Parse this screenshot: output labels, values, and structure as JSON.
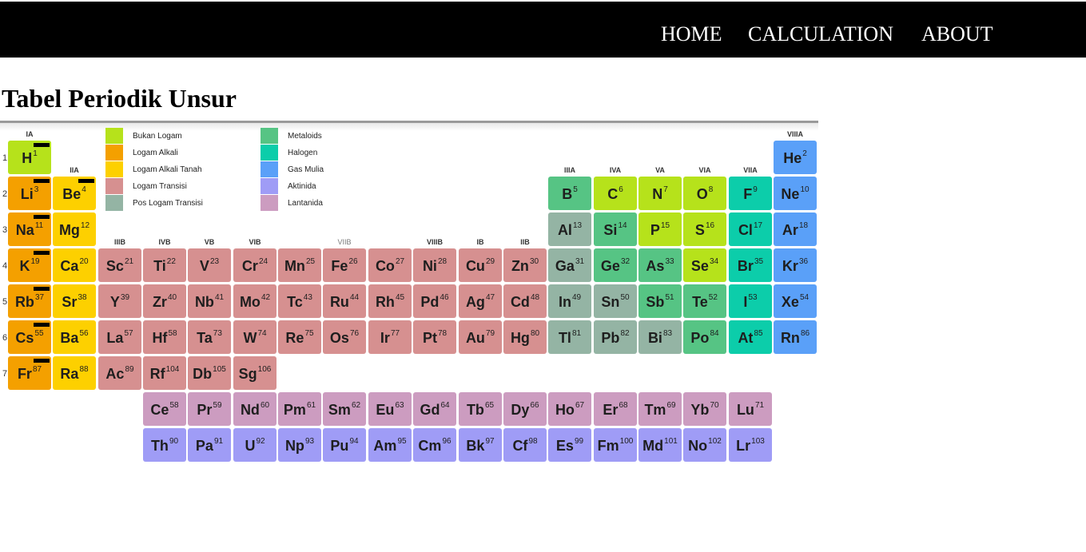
{
  "nav": {
    "items": [
      "HOME",
      "CALCULATION",
      "ABOUT"
    ]
  },
  "page": {
    "title": "Tabel Periodik Unsur"
  },
  "colors": {
    "nonmetal": "#b6e21b",
    "alkali": "#f4a000",
    "alkaline": "#fdd000",
    "transition": "#d69090",
    "post": "#94b4a4",
    "metalloid": "#56c484",
    "halogen": "#0ccdaa",
    "noble": "#5aa0f8",
    "actinide": "#9f9cf6",
    "lanthanide": "#cc9cc0"
  },
  "legend": [
    {
      "label": "Bukan Logam",
      "cat": "nonmetal"
    },
    {
      "label": "Logam Alkali",
      "cat": "alkali"
    },
    {
      "label": "Logam Alkali Tanah",
      "cat": "alkaline"
    },
    {
      "label": "Logam Transisi",
      "cat": "transition"
    },
    {
      "label": "Pos Logam Transisi",
      "cat": "post"
    },
    {
      "label": "Metaloids",
      "cat": "metalloid"
    },
    {
      "label": "Halogen",
      "cat": "halogen"
    },
    {
      "label": "Gas Mulia",
      "cat": "noble"
    },
    {
      "label": "Aktinida",
      "cat": "actinide"
    },
    {
      "label": "Lantanida",
      "cat": "lanthanide"
    }
  ],
  "group_labels": [
    {
      "col": 1,
      "row": 1,
      "text": "IA"
    },
    {
      "col": 2,
      "row": 2,
      "text": "IIA"
    },
    {
      "col": 3,
      "row": 4,
      "text": "IIIB"
    },
    {
      "col": 4,
      "row": 4,
      "text": "IVB"
    },
    {
      "col": 5,
      "row": 4,
      "text": "VB"
    },
    {
      "col": 6,
      "row": 4,
      "text": "VIB"
    },
    {
      "col": 8,
      "row": 4,
      "text": "VIIB"
    },
    {
      "col": 10,
      "row": 4,
      "text": "VIIIB"
    },
    {
      "col": 11,
      "row": 4,
      "text": "IB"
    },
    {
      "col": 12,
      "row": 4,
      "text": "IIB"
    },
    {
      "col": 13,
      "row": 2,
      "text": "IIIA"
    },
    {
      "col": 14,
      "row": 2,
      "text": "IVA"
    },
    {
      "col": 15,
      "row": 2,
      "text": "VA"
    },
    {
      "col": 16,
      "row": 2,
      "text": "VIA"
    },
    {
      "col": 17,
      "row": 2,
      "text": "VIIA"
    },
    {
      "col": 18,
      "row": 1,
      "text": "VIIIA"
    }
  ],
  "periods": [
    "1",
    "2",
    "3",
    "4",
    "5",
    "6",
    "7"
  ],
  "elements": [
    {
      "s": "H",
      "n": 1,
      "r": 1,
      "c": 1,
      "cat": "nonmetal",
      "bar": true
    },
    {
      "s": "He",
      "n": 2,
      "r": 1,
      "c": 18,
      "cat": "noble"
    },
    {
      "s": "Li",
      "n": 3,
      "r": 2,
      "c": 1,
      "cat": "alkali",
      "bar": true
    },
    {
      "s": "Be",
      "n": 4,
      "r": 2,
      "c": 2,
      "cat": "alkaline",
      "bar": true
    },
    {
      "s": "B",
      "n": 5,
      "r": 2,
      "c": 13,
      "cat": "metalloid"
    },
    {
      "s": "C",
      "n": 6,
      "r": 2,
      "c": 14,
      "cat": "nonmetal"
    },
    {
      "s": "N",
      "n": 7,
      "r": 2,
      "c": 15,
      "cat": "nonmetal"
    },
    {
      "s": "O",
      "n": 8,
      "r": 2,
      "c": 16,
      "cat": "nonmetal"
    },
    {
      "s": "F",
      "n": 9,
      "r": 2,
      "c": 17,
      "cat": "halogen"
    },
    {
      "s": "Ne",
      "n": 10,
      "r": 2,
      "c": 18,
      "cat": "noble"
    },
    {
      "s": "Na",
      "n": 11,
      "r": 3,
      "c": 1,
      "cat": "alkali",
      "bar": true
    },
    {
      "s": "Mg",
      "n": 12,
      "r": 3,
      "c": 2,
      "cat": "alkaline"
    },
    {
      "s": "Al",
      "n": 13,
      "r": 3,
      "c": 13,
      "cat": "post"
    },
    {
      "s": "Si",
      "n": 14,
      "r": 3,
      "c": 14,
      "cat": "metalloid"
    },
    {
      "s": "P",
      "n": 15,
      "r": 3,
      "c": 15,
      "cat": "nonmetal"
    },
    {
      "s": "S",
      "n": 16,
      "r": 3,
      "c": 16,
      "cat": "nonmetal"
    },
    {
      "s": "Cl",
      "n": 17,
      "r": 3,
      "c": 17,
      "cat": "halogen"
    },
    {
      "s": "Ar",
      "n": 18,
      "r": 3,
      "c": 18,
      "cat": "noble"
    },
    {
      "s": "K",
      "n": 19,
      "r": 4,
      "c": 1,
      "cat": "alkali",
      "bar": true
    },
    {
      "s": "Ca",
      "n": 20,
      "r": 4,
      "c": 2,
      "cat": "alkaline"
    },
    {
      "s": "Sc",
      "n": 21,
      "r": 4,
      "c": 3,
      "cat": "transition"
    },
    {
      "s": "Ti",
      "n": 22,
      "r": 4,
      "c": 4,
      "cat": "transition"
    },
    {
      "s": "V",
      "n": 23,
      "r": 4,
      "c": 5,
      "cat": "transition"
    },
    {
      "s": "Cr",
      "n": 24,
      "r": 4,
      "c": 6,
      "cat": "transition"
    },
    {
      "s": "Mn",
      "n": 25,
      "r": 4,
      "c": 7,
      "cat": "transition"
    },
    {
      "s": "Fe",
      "n": 26,
      "r": 4,
      "c": 8,
      "cat": "transition"
    },
    {
      "s": "Co",
      "n": 27,
      "r": 4,
      "c": 9,
      "cat": "transition"
    },
    {
      "s": "Ni",
      "n": 28,
      "r": 4,
      "c": 10,
      "cat": "transition"
    },
    {
      "s": "Cu",
      "n": 29,
      "r": 4,
      "c": 11,
      "cat": "transition"
    },
    {
      "s": "Zn",
      "n": 30,
      "r": 4,
      "c": 12,
      "cat": "transition"
    },
    {
      "s": "Ga",
      "n": 31,
      "r": 4,
      "c": 13,
      "cat": "post"
    },
    {
      "s": "Ge",
      "n": 32,
      "r": 4,
      "c": 14,
      "cat": "metalloid"
    },
    {
      "s": "As",
      "n": 33,
      "r": 4,
      "c": 15,
      "cat": "metalloid"
    },
    {
      "s": "Se",
      "n": 34,
      "r": 4,
      "c": 16,
      "cat": "nonmetal"
    },
    {
      "s": "Br",
      "n": 35,
      "r": 4,
      "c": 17,
      "cat": "halogen"
    },
    {
      "s": "Kr",
      "n": 36,
      "r": 4,
      "c": 18,
      "cat": "noble"
    },
    {
      "s": "Rb",
      "n": 37,
      "r": 5,
      "c": 1,
      "cat": "alkali",
      "bar": true
    },
    {
      "s": "Sr",
      "n": 38,
      "r": 5,
      "c": 2,
      "cat": "alkaline"
    },
    {
      "s": "Y",
      "n": 39,
      "r": 5,
      "c": 3,
      "cat": "transition"
    },
    {
      "s": "Zr",
      "n": 40,
      "r": 5,
      "c": 4,
      "cat": "transition"
    },
    {
      "s": "Nb",
      "n": 41,
      "r": 5,
      "c": 5,
      "cat": "transition"
    },
    {
      "s": "Mo",
      "n": 42,
      "r": 5,
      "c": 6,
      "cat": "transition"
    },
    {
      "s": "Tc",
      "n": 43,
      "r": 5,
      "c": 7,
      "cat": "transition"
    },
    {
      "s": "Ru",
      "n": 44,
      "r": 5,
      "c": 8,
      "cat": "transition"
    },
    {
      "s": "Rh",
      "n": 45,
      "r": 5,
      "c": 9,
      "cat": "transition"
    },
    {
      "s": "Pd",
      "n": 46,
      "r": 5,
      "c": 10,
      "cat": "transition"
    },
    {
      "s": "Ag",
      "n": 47,
      "r": 5,
      "c": 11,
      "cat": "transition"
    },
    {
      "s": "Cd",
      "n": 48,
      "r": 5,
      "c": 12,
      "cat": "transition"
    },
    {
      "s": "In",
      "n": 49,
      "r": 5,
      "c": 13,
      "cat": "post"
    },
    {
      "s": "Sn",
      "n": 50,
      "r": 5,
      "c": 14,
      "cat": "post"
    },
    {
      "s": "Sb",
      "n": 51,
      "r": 5,
      "c": 15,
      "cat": "metalloid"
    },
    {
      "s": "Te",
      "n": 52,
      "r": 5,
      "c": 16,
      "cat": "metalloid"
    },
    {
      "s": "I",
      "n": 53,
      "r": 5,
      "c": 17,
      "cat": "halogen"
    },
    {
      "s": "Xe",
      "n": 54,
      "r": 5,
      "c": 18,
      "cat": "noble"
    },
    {
      "s": "Cs",
      "n": 55,
      "r": 6,
      "c": 1,
      "cat": "alkali",
      "bar": true
    },
    {
      "s": "Ba",
      "n": 56,
      "r": 6,
      "c": 2,
      "cat": "alkaline"
    },
    {
      "s": "La",
      "n": 57,
      "r": 6,
      "c": 3,
      "cat": "transition"
    },
    {
      "s": "Hf",
      "n": 58,
      "r": 6,
      "c": 4,
      "cat": "transition"
    },
    {
      "s": "Ta",
      "n": 73,
      "r": 6,
      "c": 5,
      "cat": "transition"
    },
    {
      "s": "W",
      "n": 74,
      "r": 6,
      "c": 6,
      "cat": "transition"
    },
    {
      "s": "Re",
      "n": 75,
      "r": 6,
      "c": 7,
      "cat": "transition"
    },
    {
      "s": "Os",
      "n": 76,
      "r": 6,
      "c": 8,
      "cat": "transition"
    },
    {
      "s": "Ir",
      "n": 77,
      "r": 6,
      "c": 9,
      "cat": "transition"
    },
    {
      "s": "Pt",
      "n": 78,
      "r": 6,
      "c": 10,
      "cat": "transition"
    },
    {
      "s": "Au",
      "n": 79,
      "r": 6,
      "c": 11,
      "cat": "transition"
    },
    {
      "s": "Hg",
      "n": 80,
      "r": 6,
      "c": 12,
      "cat": "transition"
    },
    {
      "s": "Tl",
      "n": 81,
      "r": 6,
      "c": 13,
      "cat": "post"
    },
    {
      "s": "Pb",
      "n": 82,
      "r": 6,
      "c": 14,
      "cat": "post"
    },
    {
      "s": "Bi",
      "n": 83,
      "r": 6,
      "c": 15,
      "cat": "post"
    },
    {
      "s": "Po",
      "n": 84,
      "r": 6,
      "c": 16,
      "cat": "metalloid"
    },
    {
      "s": "At",
      "n": 85,
      "r": 6,
      "c": 17,
      "cat": "halogen"
    },
    {
      "s": "Rn",
      "n": 86,
      "r": 6,
      "c": 18,
      "cat": "noble"
    },
    {
      "s": "Fr",
      "n": 87,
      "r": 7,
      "c": 1,
      "cat": "alkali",
      "bar": true
    },
    {
      "s": "Ra",
      "n": 88,
      "r": 7,
      "c": 2,
      "cat": "alkaline"
    },
    {
      "s": "Ac",
      "n": 89,
      "r": 7,
      "c": 3,
      "cat": "transition"
    },
    {
      "s": "Rf",
      "n": 104,
      "r": 7,
      "c": 4,
      "cat": "transition"
    },
    {
      "s": "Db",
      "n": 105,
      "r": 7,
      "c": 5,
      "cat": "transition"
    },
    {
      "s": "Sg",
      "n": 106,
      "r": 7,
      "c": 6,
      "cat": "transition"
    },
    {
      "s": "Ce",
      "n": 58,
      "r": 8,
      "c": 4,
      "cat": "lanthanide"
    },
    {
      "s": "Pr",
      "n": 59,
      "r": 8,
      "c": 5,
      "cat": "lanthanide"
    },
    {
      "s": "Nd",
      "n": 60,
      "r": 8,
      "c": 6,
      "cat": "lanthanide"
    },
    {
      "s": "Pm",
      "n": 61,
      "r": 8,
      "c": 7,
      "cat": "lanthanide"
    },
    {
      "s": "Sm",
      "n": 62,
      "r": 8,
      "c": 8,
      "cat": "lanthanide"
    },
    {
      "s": "Eu",
      "n": 63,
      "r": 8,
      "c": 9,
      "cat": "lanthanide"
    },
    {
      "s": "Gd",
      "n": 64,
      "r": 8,
      "c": 10,
      "cat": "lanthanide"
    },
    {
      "s": "Tb",
      "n": 65,
      "r": 8,
      "c": 11,
      "cat": "lanthanide"
    },
    {
      "s": "Dy",
      "n": 66,
      "r": 8,
      "c": 12,
      "cat": "lanthanide"
    },
    {
      "s": "Ho",
      "n": 67,
      "r": 8,
      "c": 13,
      "cat": "lanthanide"
    },
    {
      "s": "Er",
      "n": 68,
      "r": 8,
      "c": 14,
      "cat": "lanthanide"
    },
    {
      "s": "Tm",
      "n": 69,
      "r": 8,
      "c": 15,
      "cat": "lanthanide"
    },
    {
      "s": "Yb",
      "n": 70,
      "r": 8,
      "c": 16,
      "cat": "lanthanide"
    },
    {
      "s": "Lu",
      "n": 71,
      "r": 8,
      "c": 17,
      "cat": "lanthanide"
    },
    {
      "s": "Th",
      "n": 90,
      "r": 9,
      "c": 4,
      "cat": "actinide"
    },
    {
      "s": "Pa",
      "n": 91,
      "r": 9,
      "c": 5,
      "cat": "actinide"
    },
    {
      "s": "U",
      "n": 92,
      "r": 9,
      "c": 6,
      "cat": "actinide"
    },
    {
      "s": "Np",
      "n": 93,
      "r": 9,
      "c": 7,
      "cat": "actinide"
    },
    {
      "s": "Pu",
      "n": 94,
      "r": 9,
      "c": 8,
      "cat": "actinide"
    },
    {
      "s": "Am",
      "n": 95,
      "r": 9,
      "c": 9,
      "cat": "actinide"
    },
    {
      "s": "Cm",
      "n": 96,
      "r": 9,
      "c": 10,
      "cat": "actinide"
    },
    {
      "s": "Bk",
      "n": 97,
      "r": 9,
      "c": 11,
      "cat": "actinide"
    },
    {
      "s": "Cf",
      "n": 98,
      "r": 9,
      "c": 12,
      "cat": "actinide"
    },
    {
      "s": "Es",
      "n": 99,
      "r": 9,
      "c": 13,
      "cat": "actinide"
    },
    {
      "s": "Fm",
      "n": 100,
      "r": 9,
      "c": 14,
      "cat": "actinide"
    },
    {
      "s": "Md",
      "n": 101,
      "r": 9,
      "c": 15,
      "cat": "actinide"
    },
    {
      "s": "No",
      "n": 102,
      "r": 9,
      "c": 16,
      "cat": "actinide"
    },
    {
      "s": "Lr",
      "n": 103,
      "r": 9,
      "c": 17,
      "cat": "actinide"
    }
  ]
}
